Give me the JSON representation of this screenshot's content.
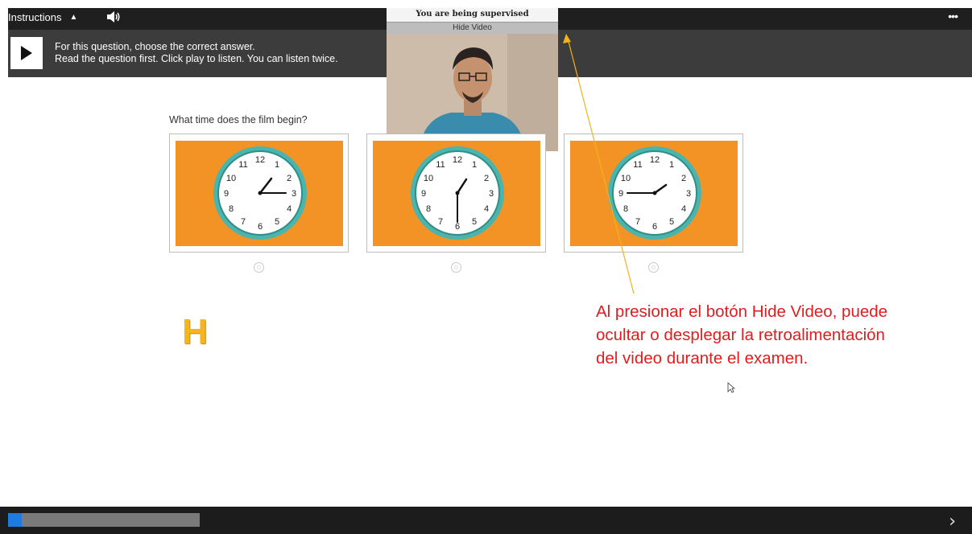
{
  "topbar": {
    "instructions_label": "Instructions",
    "instructions_arrow_icon": "caret-up-icon",
    "audio_icon": "speaker-icon",
    "more_icon": "ellipsis-icon"
  },
  "instructions": {
    "line1": "For this question, choose the correct answer.",
    "line2": "Read the question first. Click play to listen. You can listen twice."
  },
  "proctor_video": {
    "title": "You are being supervised",
    "hide_label": "Hide Video"
  },
  "question": {
    "text": "What time does the film begin?",
    "options": [
      {
        "time": "2:15",
        "radio_selected": false
      },
      {
        "time": "6:00 / 1:30",
        "radio_selected": false
      },
      {
        "time": "2:45",
        "radio_selected": false
      }
    ]
  },
  "watermark_letter": "H",
  "annotation": {
    "line1": "Al presionar el botón Hide Video, puede",
    "line2": "ocultar o desplegar la retroalimentación",
    "line3": "del video durante el examen."
  },
  "progress": {
    "fraction": 0.07
  },
  "navigation": {
    "next_icon": "chevron-right-icon"
  },
  "colors": {
    "card_background": "#f39325",
    "annotation_text": "#e11d1d",
    "progress_fill": "#1e7be0",
    "clock_rim": "#4bb5ad",
    "letter": "#f5b51d"
  }
}
